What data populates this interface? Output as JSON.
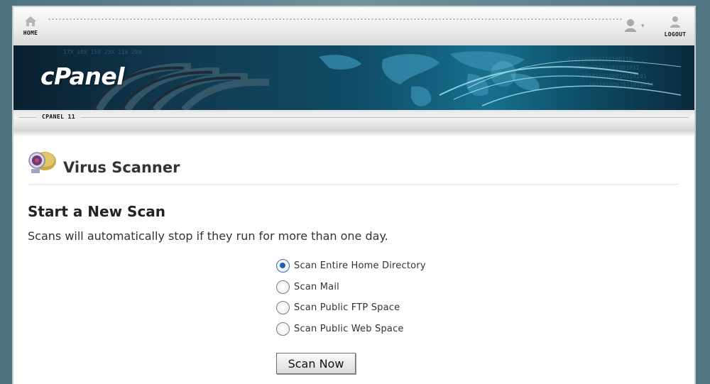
{
  "topnav": {
    "home_label": "HOME",
    "logout_label": "LOGOUT",
    "user_caret": "▾",
    "icons": [
      "home-icon",
      "user-icon",
      "logout-icon"
    ]
  },
  "banner": {
    "logo_text": "cPanel"
  },
  "breadcrumb": {
    "label": "CPANEL 11"
  },
  "page": {
    "title": "Virus Scanner",
    "icon": "virus-scanner-icon"
  },
  "scan": {
    "heading": "Start a New Scan",
    "description": "Scans will automatically stop if they run for more than one day.",
    "options": [
      {
        "label": "Scan Entire Home Directory",
        "checked": true
      },
      {
        "label": "Scan Mail",
        "checked": false
      },
      {
        "label": "Scan Public FTP Space",
        "checked": false
      },
      {
        "label": "Scan Public Web Space",
        "checked": false
      }
    ],
    "button_label": "Scan Now"
  },
  "colors": {
    "radio_selected": "#1f5fae",
    "banner_accent": "#17708e"
  }
}
